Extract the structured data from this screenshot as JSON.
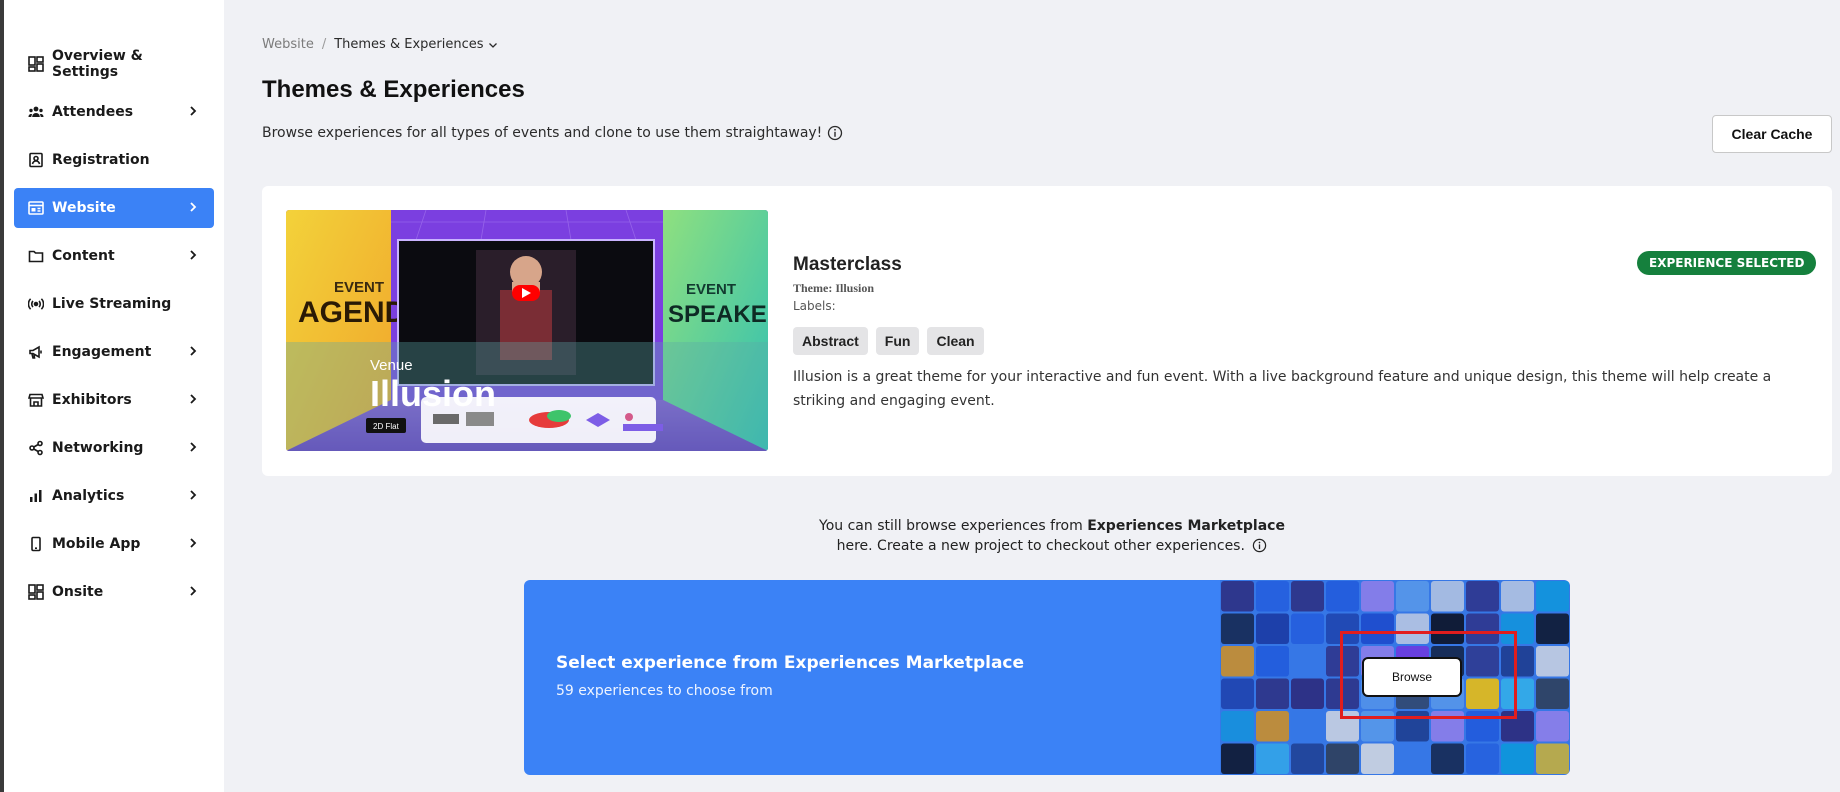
{
  "sidebar": {
    "items": [
      {
        "label": "Overview & Settings",
        "icon": "dashboard-icon",
        "chevron": false
      },
      {
        "label": "Attendees",
        "icon": "users-icon",
        "chevron": true
      },
      {
        "label": "Registration",
        "icon": "id-card-icon",
        "chevron": false
      },
      {
        "label": "Website",
        "icon": "browser-icon",
        "chevron": true,
        "active": true
      },
      {
        "label": "Content",
        "icon": "folder-icon",
        "chevron": true
      },
      {
        "label": "Live Streaming",
        "icon": "broadcast-icon",
        "chevron": false
      },
      {
        "label": "Engagement",
        "icon": "megaphone-icon",
        "chevron": true
      },
      {
        "label": "Exhibitors",
        "icon": "store-icon",
        "chevron": true
      },
      {
        "label": "Networking",
        "icon": "share-nodes-icon",
        "chevron": true
      },
      {
        "label": "Analytics",
        "icon": "bar-chart-icon",
        "chevron": true
      },
      {
        "label": "Mobile App",
        "icon": "mobile-icon",
        "chevron": true
      },
      {
        "label": "Onsite",
        "icon": "grid-icon",
        "chevron": true
      }
    ]
  },
  "breadcrumb": {
    "parent": "Website",
    "separator": "/",
    "current": "Themes & Experiences"
  },
  "page": {
    "title": "Themes & Experiences",
    "subtitle": "Browse experiences for all types of events and clone to use them straightaway!",
    "clear_cache_label": "Clear Cache"
  },
  "experience": {
    "name": "Masterclass",
    "theme": "Theme: Illusion",
    "labels_caption": "Labels:",
    "tags": [
      "Abstract",
      "Fun",
      "Clean"
    ],
    "description": "Illusion is a great theme for your interactive and fun event. With a live background feature and unique design, this theme will help create a striking and engaging event.",
    "badge": "EXPERIENCE SELECTED",
    "thumbnail": {
      "left_panel": [
        "EVENT",
        "AGENDA"
      ],
      "right_panel": [
        "EVENT",
        "SPEAKERS"
      ],
      "venue": "Venue",
      "name": "Illusion",
      "flat_badge": "2D Flat"
    }
  },
  "marketplace": {
    "note_prefix": "You can still browse experiences from",
    "note_bold": "Experiences Marketplace",
    "note_line2": "here. Create a new project to checkout other experiences.",
    "banner_title": "Select experience from Experiences Marketplace",
    "banner_sub": "59 experiences to choose from",
    "browse_label": "Browse"
  },
  "colors": {
    "accent": "#3b82f6",
    "badge_green": "#15803d",
    "highlight_red": "#e11d1d",
    "page_bg": "#f0f1f5"
  }
}
